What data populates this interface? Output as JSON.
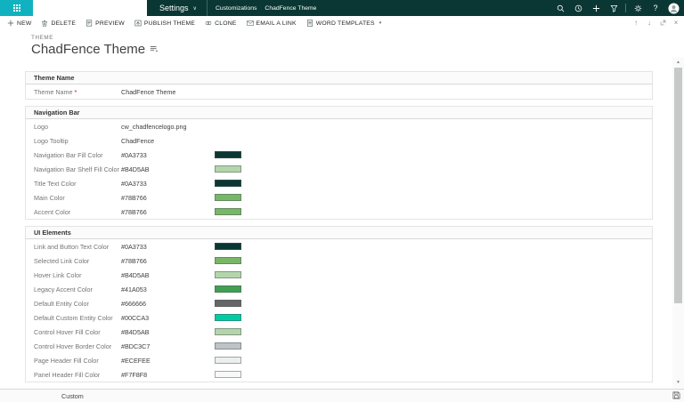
{
  "topbar": {
    "bg": "#0A3733",
    "launcher_bg": "#10B2BF",
    "settings_label": "Settings",
    "breadcrumb": [
      "Customizations",
      "ChadFence Theme"
    ],
    "icons_right": [
      {
        "name": "search"
      },
      {
        "name": "recent"
      },
      {
        "name": "add"
      },
      {
        "name": "filter"
      },
      {
        "divider": true
      },
      {
        "name": "gear"
      },
      {
        "name": "help"
      },
      {
        "name": "avatar"
      }
    ]
  },
  "command_bar": {
    "items": [
      {
        "label": "NEW",
        "icon": "plus"
      },
      {
        "label": "DELETE",
        "icon": "trash"
      },
      {
        "label": "PREVIEW",
        "icon": "preview"
      },
      {
        "label": "PUBLISH THEME",
        "icon": "publish"
      },
      {
        "label": "CLONE",
        "icon": "clone"
      },
      {
        "label": "EMAIL A LINK",
        "icon": "email"
      },
      {
        "label": "WORD TEMPLATES",
        "icon": "word",
        "caret": true
      }
    ],
    "window_controls": [
      {
        "name": "previous-record",
        "glyph": "↑"
      },
      {
        "name": "next-record",
        "glyph": "↓"
      },
      {
        "name": "popout",
        "glyph": ""
      },
      {
        "name": "close",
        "glyph": "×"
      }
    ]
  },
  "record_header": {
    "entity_label": "THEME",
    "title": "ChadFence Theme"
  },
  "form": {
    "sections": [
      {
        "title": "Theme Name",
        "rows": [
          {
            "label": "Theme Name",
            "required": true,
            "value": "ChadFence Theme"
          }
        ]
      },
      {
        "title": "Navigation Bar",
        "rows": [
          {
            "label": "Logo",
            "value": "cw_chadfencelogo.png"
          },
          {
            "label": "Logo Tooltip",
            "value": "ChadFence"
          },
          {
            "label": "Navigation Bar Fill Color",
            "value": "#0A3733",
            "swatch": "#0A3733"
          },
          {
            "label": "Navigation Bar Shelf Fill Color",
            "value": "#B4D5AB",
            "swatch": "#B4D5AB"
          },
          {
            "label": "Title Text Color",
            "value": "#0A3733",
            "swatch": "#0A3733"
          },
          {
            "label": "Main Color",
            "value": "#78B766",
            "swatch": "#78B766"
          },
          {
            "label": "Accent Color",
            "value": "#78B766",
            "swatch": "#78B766"
          }
        ]
      },
      {
        "title": "UI Elements",
        "rows": [
          {
            "label": "Link and Button Text Color",
            "value": "#0A3733",
            "swatch": "#0A3733"
          },
          {
            "label": "Selected Link Color",
            "value": "#78B766",
            "swatch": "#78B766"
          },
          {
            "label": "Hover Link Color",
            "value": "#B4D5AB",
            "swatch": "#B4D5AB"
          },
          {
            "label": "Legacy Accent Color",
            "value": "#41A053",
            "swatch": "#41A053"
          },
          {
            "label": "Default Entity Color",
            "value": "#666666",
            "swatch": "#666666"
          },
          {
            "label": "Default Custom Entity Color",
            "value": "#00CCA3",
            "swatch": "#00CCA3"
          },
          {
            "label": "Control Hover Fill Color",
            "value": "#B4D5AB",
            "swatch": "#B4D5AB"
          },
          {
            "label": "Control Hover Border Color",
            "value": "#BDC3C7",
            "swatch": "#BDC3C7"
          },
          {
            "label": "Page Header Fill Color",
            "value": "#ECEFEE",
            "swatch": "#ECEFEE"
          },
          {
            "label": "Panel Header Fill Color",
            "value": "#F7F8F8",
            "swatch": "#F7F8F8"
          }
        ]
      }
    ]
  },
  "footer": {
    "status": "Custom",
    "save_icon": "save-icon"
  }
}
